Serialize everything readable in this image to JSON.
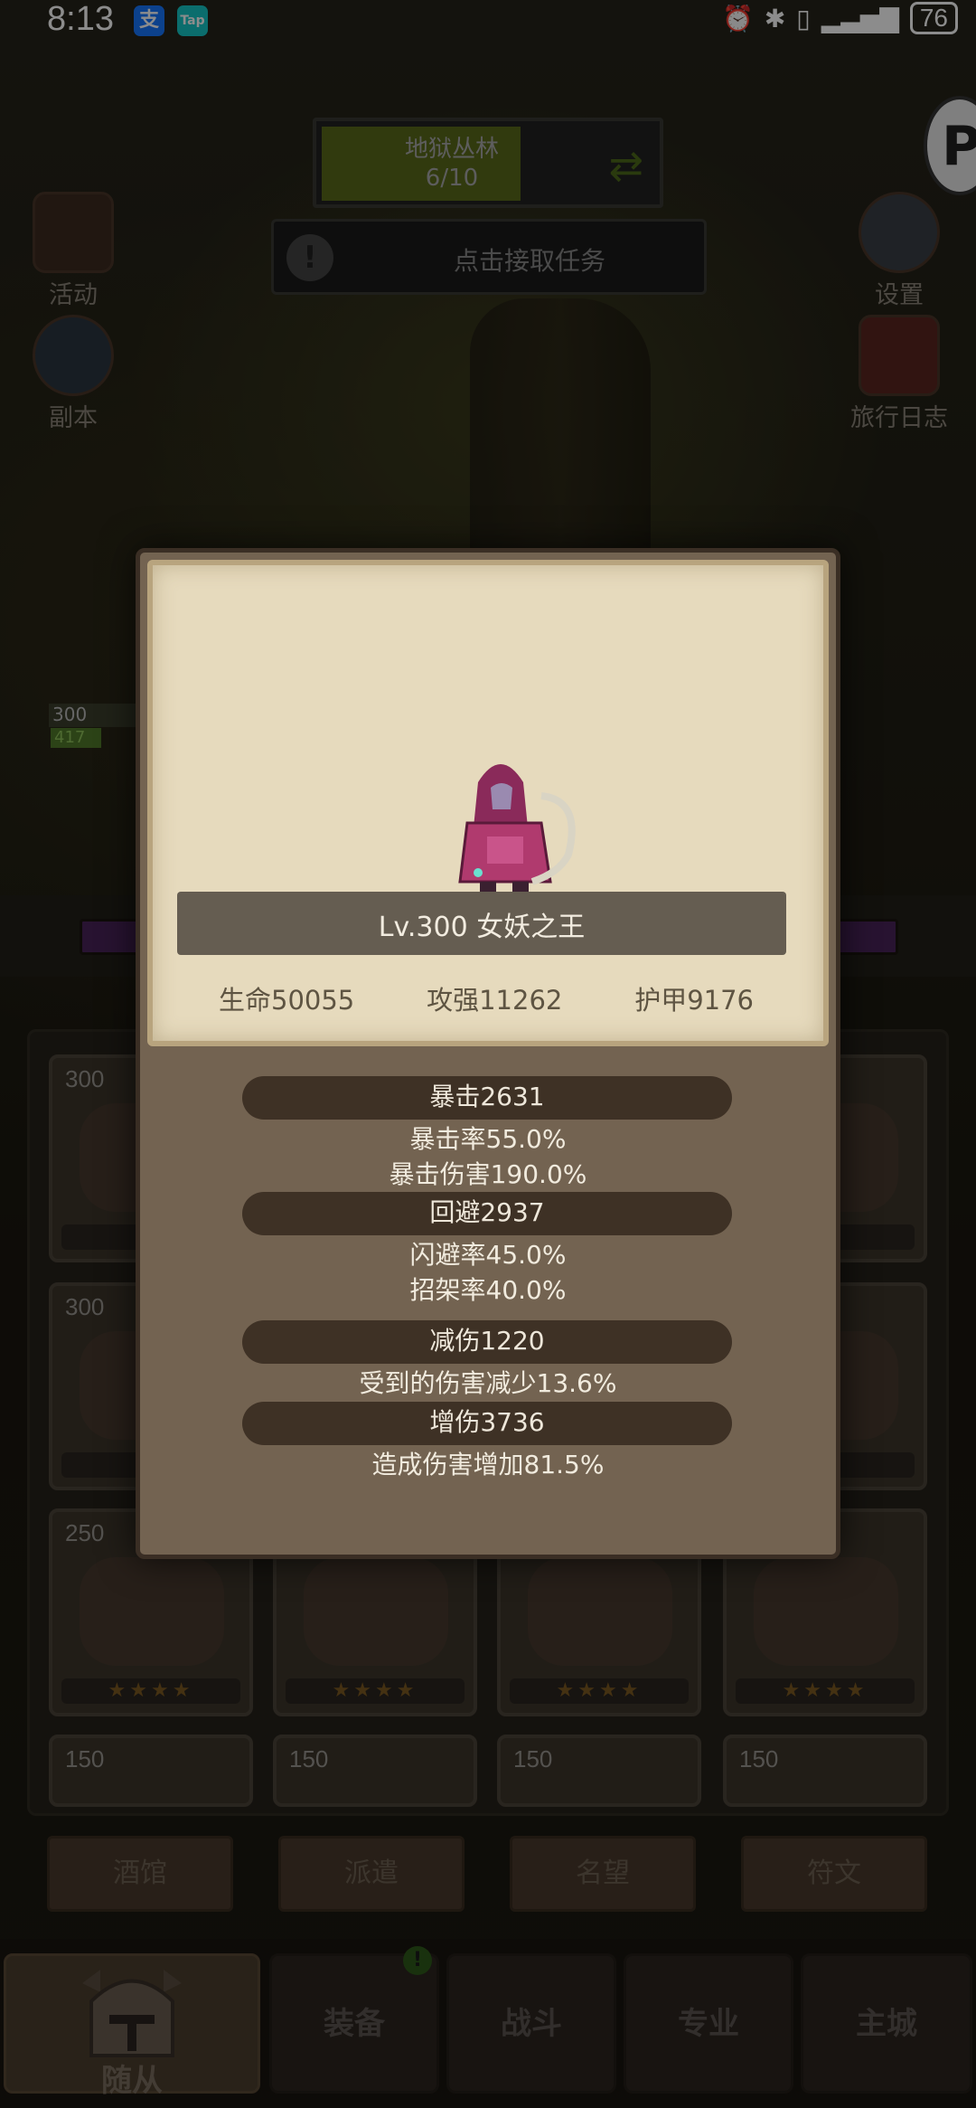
{
  "status_bar": {
    "time": "8:13",
    "apps": [
      "支",
      "Tap"
    ],
    "battery": "76"
  },
  "hud": {
    "quest_title": "地狱丛林",
    "quest_progress": "6/10",
    "task_text": "点击接取任务",
    "left_icons": [
      "活动",
      "副本"
    ],
    "right_icons": [
      "设置",
      "旅行日志"
    ],
    "hero_level_tag": "300",
    "hero_hp_tag": "417"
  },
  "roster": {
    "rows": [
      {
        "level": "300",
        "stars": "★"
      },
      {
        "level": "300",
        "stars": "★"
      },
      {
        "level": "250",
        "stars": "★★★★"
      },
      {
        "level": "150",
        "stars": ""
      }
    ],
    "right_stars": "★",
    "mid_levels": [
      "150",
      "150",
      "150"
    ]
  },
  "sub_tabs": [
    "酒馆",
    "派遣",
    "名望",
    "符文"
  ],
  "bottom_nav": {
    "items": [
      "随从",
      "装备",
      "战斗",
      "专业",
      "主城"
    ],
    "badge": "!"
  },
  "hero_detail": {
    "name": "Lv.300 女妖之王",
    "base_stats": [
      "生命50055",
      "攻强11262",
      "护甲9176"
    ],
    "crit": {
      "title": "暴击2631",
      "lines": [
        "暴击率55.0%",
        "暴击伤害190.0%"
      ]
    },
    "dodge": {
      "title": "回避2937",
      "lines": [
        "闪避率45.0%",
        "招架率40.0%"
      ]
    },
    "reduce": {
      "title": "减伤1220",
      "lines": [
        "受到的伤害减少13.6%"
      ]
    },
    "boost": {
      "title": "增伤3736",
      "lines": [
        "造成伤害增加81.5%"
      ]
    }
  }
}
